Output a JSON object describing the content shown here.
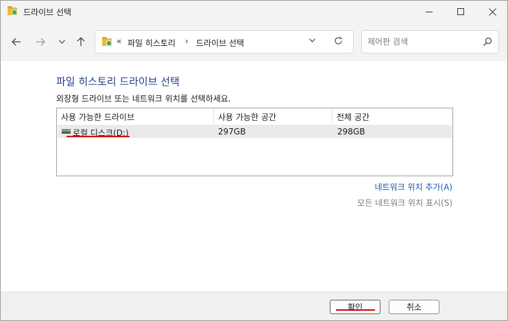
{
  "window": {
    "title": "드라이브 선택"
  },
  "nav": {
    "back_icon": "arrow-left",
    "forward_icon": "arrow-right",
    "recent_icon": "chevron-down",
    "up_icon": "arrow-up"
  },
  "address_bar": {
    "chevrons": "«",
    "crumbs": [
      "파일 히스토리",
      "드라이브 선택"
    ],
    "separator": "›"
  },
  "search": {
    "placeholder": "제어판 검색"
  },
  "content": {
    "title": "파일 히스토리 드라이브 선택",
    "description": "외장형 드라이브 또는 네트워크 위치를 선택하세요.",
    "table": {
      "headers": [
        "사용 가능한 드라이브",
        "사용 가능한 공간",
        "전체 공간"
      ],
      "rows": [
        {
          "name": "로컬 디스크(D:)",
          "free": "297GB",
          "total": "298GB"
        }
      ]
    },
    "link_add": "네트워크 위치 추가(A)",
    "link_show": "모든 네트워크 위치 표시(S)"
  },
  "footer": {
    "ok": "확인",
    "cancel": "취소"
  },
  "colors": {
    "title_blue": "#1e3f8a",
    "link_blue": "#1a5aa8",
    "annotation_red": "#d40000"
  }
}
